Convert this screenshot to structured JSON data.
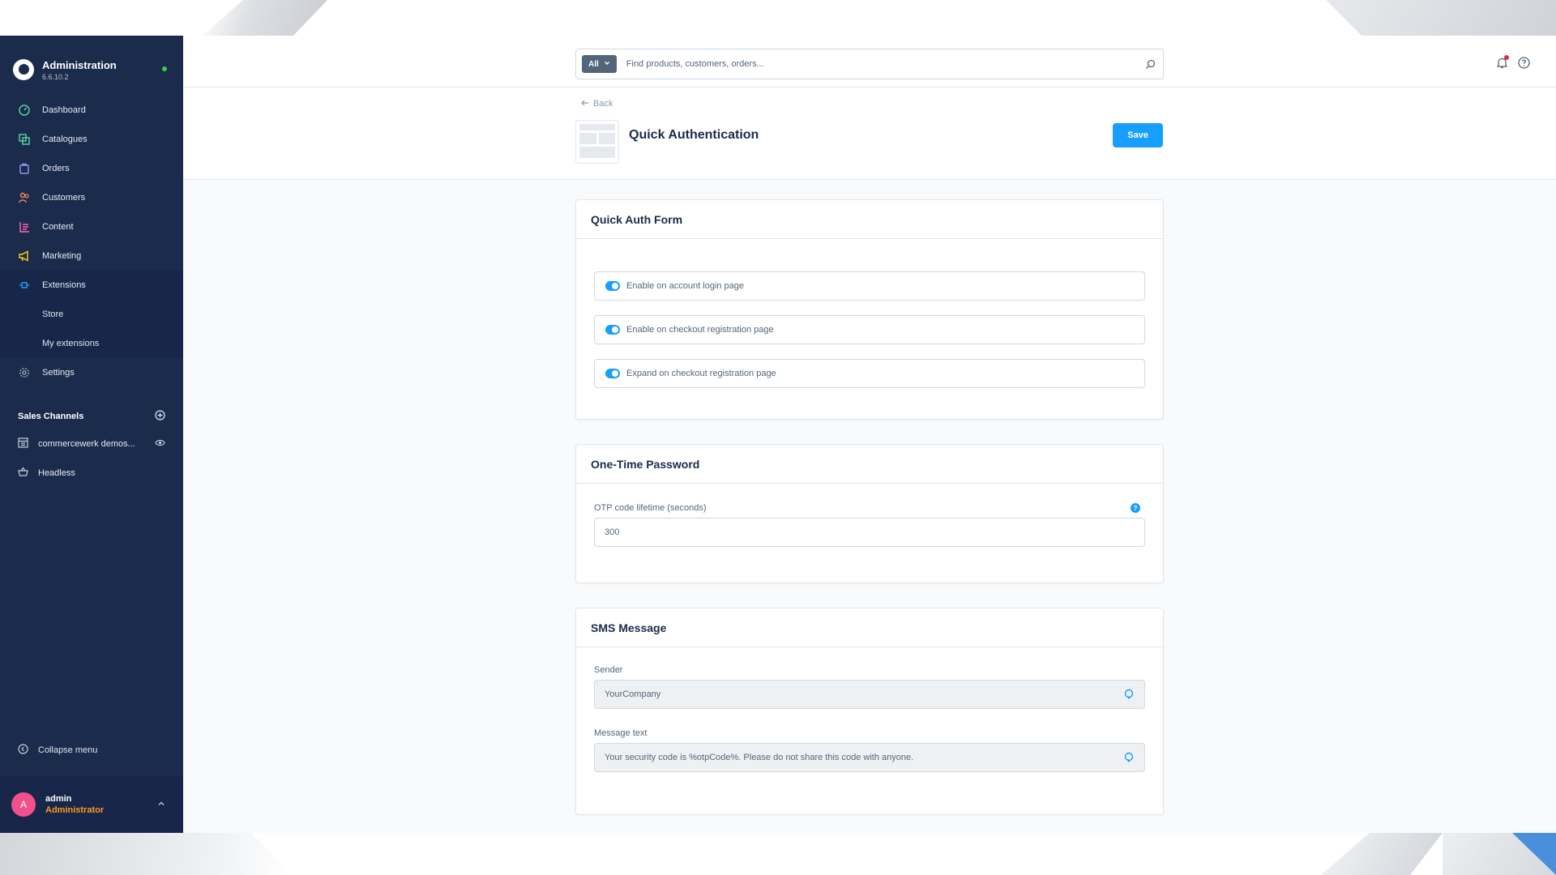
{
  "colors": {
    "sidebar_bg": "#1b2b4b",
    "accent": "#189eff",
    "role": "#ff9a1f",
    "avatar": "#f0508c",
    "online": "#37d046"
  },
  "sidebar": {
    "app_title": "Administration",
    "version": "6.6.10.2",
    "nav": [
      {
        "label": "Dashboard",
        "icon": "dashboard-icon",
        "color": "#57d9a3"
      },
      {
        "label": "Catalogues",
        "icon": "catalogue-icon",
        "color": "#57d9a3"
      },
      {
        "label": "Orders",
        "icon": "orders-icon",
        "color": "#a092f0"
      },
      {
        "label": "Customers",
        "icon": "customers-icon",
        "color": "#f88962"
      },
      {
        "label": "Content",
        "icon": "content-icon",
        "color": "#ff68b4"
      },
      {
        "label": "Marketing",
        "icon": "marketing-icon",
        "color": "#ffd700"
      },
      {
        "label": "Extensions",
        "icon": "extensions-icon",
        "color": "#189eff"
      },
      {
        "label": "Settings",
        "icon": "settings-icon",
        "color": "#9aa8b5"
      }
    ],
    "extension_sub": [
      "Store",
      "My extensions"
    ],
    "sales_channels": {
      "title": "Sales Channels",
      "items": [
        {
          "label": "commercewerk demos...",
          "icon": "storefront-icon"
        },
        {
          "label": "Headless",
          "icon": "basket-icon"
        }
      ]
    },
    "collapse_label": "Collapse menu",
    "user": {
      "initial": "A",
      "name": "admin",
      "role": "Administrator"
    }
  },
  "topbar": {
    "search_type": "All",
    "search_placeholder": "Find products, customers, orders..."
  },
  "header": {
    "back_label": "Back",
    "title": "Quick Authentication",
    "save_label": "Save"
  },
  "cards": {
    "quick_auth": {
      "title": "Quick Auth Form",
      "switches": [
        {
          "label": "Enable on account login page",
          "checked": true
        },
        {
          "label": "Enable on checkout registration page",
          "checked": true
        },
        {
          "label": "Expand on checkout registration page",
          "checked": true
        }
      ]
    },
    "otp": {
      "title": "One-Time Password",
      "field_label": "OTP code lifetime (seconds)",
      "field_value": "300",
      "help_glyph": "?"
    },
    "sms": {
      "title": "SMS Message",
      "sender_label": "Sender",
      "sender_value": "YourCompany",
      "message_label": "Message text",
      "message_value": "Your security code is %otpCode%. Please do not share this code with anyone."
    }
  }
}
